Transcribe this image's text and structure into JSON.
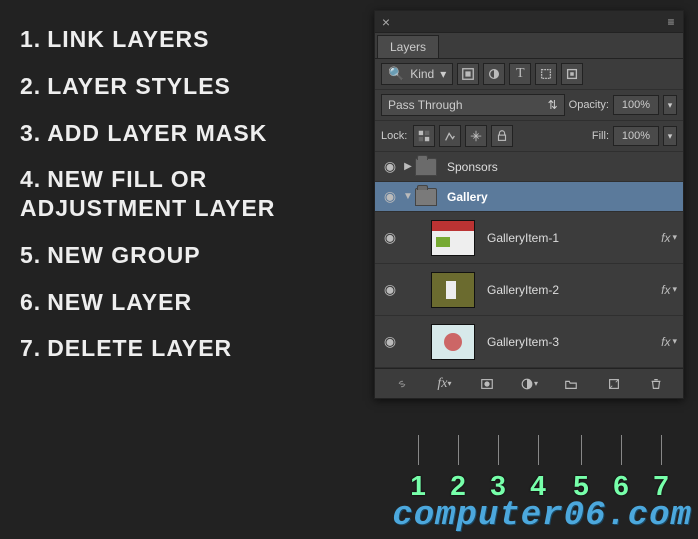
{
  "legend": [
    {
      "n": "1.",
      "label": "LINK LAYERS"
    },
    {
      "n": "2.",
      "label": "LAYER STYLES"
    },
    {
      "n": "3.",
      "label": "ADD LAYER MASK"
    },
    {
      "n": "4.",
      "label": "NEW FILL OR ADJUSTMENT LAYER"
    },
    {
      "n": "5.",
      "label": "NEW GROUP"
    },
    {
      "n": "6.",
      "label": "NEW LAYER"
    },
    {
      "n": "7.",
      "label": "DELETE LAYER"
    }
  ],
  "panel": {
    "title": "Layers",
    "filter": {
      "mode": "Kind"
    },
    "blend": {
      "mode": "Pass Through",
      "opacity_label": "Opacity:",
      "opacity": "100%"
    },
    "lock": {
      "label": "Lock:",
      "fill_label": "Fill:",
      "fill": "100%"
    },
    "groups": [
      {
        "name": "Sponsors",
        "expanded": false,
        "selected": false
      },
      {
        "name": "Gallery",
        "expanded": true,
        "selected": true,
        "items": [
          {
            "name": "GalleryItem-1",
            "fx": "fx"
          },
          {
            "name": "GalleryItem-2",
            "fx": "fx"
          },
          {
            "name": "GalleryItem-3",
            "fx": "fx"
          }
        ]
      }
    ]
  },
  "callout_numbers": [
    "1",
    "2",
    "3",
    "4",
    "5",
    "6",
    "7"
  ],
  "watermark": "computer06.com"
}
